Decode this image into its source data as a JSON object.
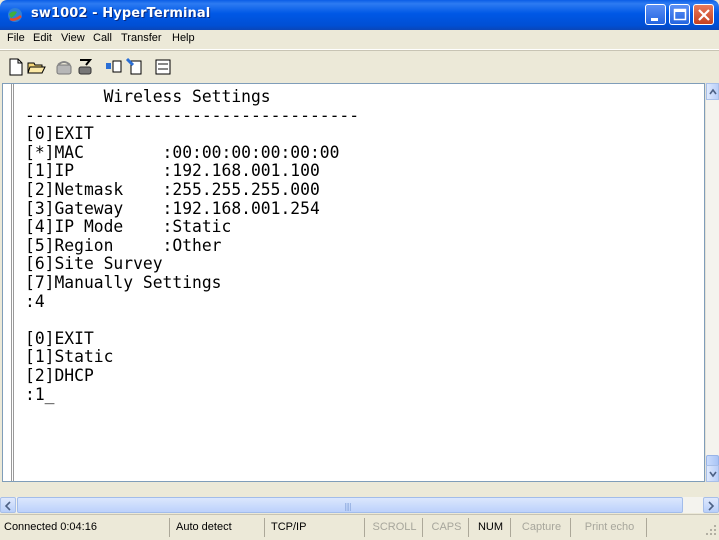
{
  "window": {
    "title": "sw1002 - HyperTerminal"
  },
  "menu": [
    "File",
    "Edit",
    "View",
    "Call",
    "Transfer",
    "Help"
  ],
  "toolbar": {
    "icons": [
      "new-document-icon",
      "open-folder-icon",
      "connect-phone-icon",
      "disconnect-icon",
      "send-file-icon",
      "receive-file-icon",
      "properties-icon"
    ]
  },
  "terminal": {
    "lines": [
      "        Wireless Settings",
      "----------------------------------",
      "[0]EXIT",
      "[*]MAC        :00:00:00:00:00:00",
      "[1]IP         :192.168.001.100",
      "[2]Netmask    :255.255.255.000",
      "[3]Gateway    :192.168.001.254",
      "[4]IP Mode    :Static",
      "[5]Region     :Other",
      "[6]Site Survey",
      "[7]Manually Settings",
      ":4",
      "",
      "[0]EXIT",
      "[1]Static",
      "[2]DHCP",
      ":1_"
    ]
  },
  "status": {
    "connected": "Connected 0:04:16",
    "detect": "Auto detect",
    "protocol": "TCP/IP",
    "scroll": "SCROLL",
    "caps": "CAPS",
    "num": "NUM",
    "capture": "Capture",
    "print_echo": "Print echo"
  }
}
